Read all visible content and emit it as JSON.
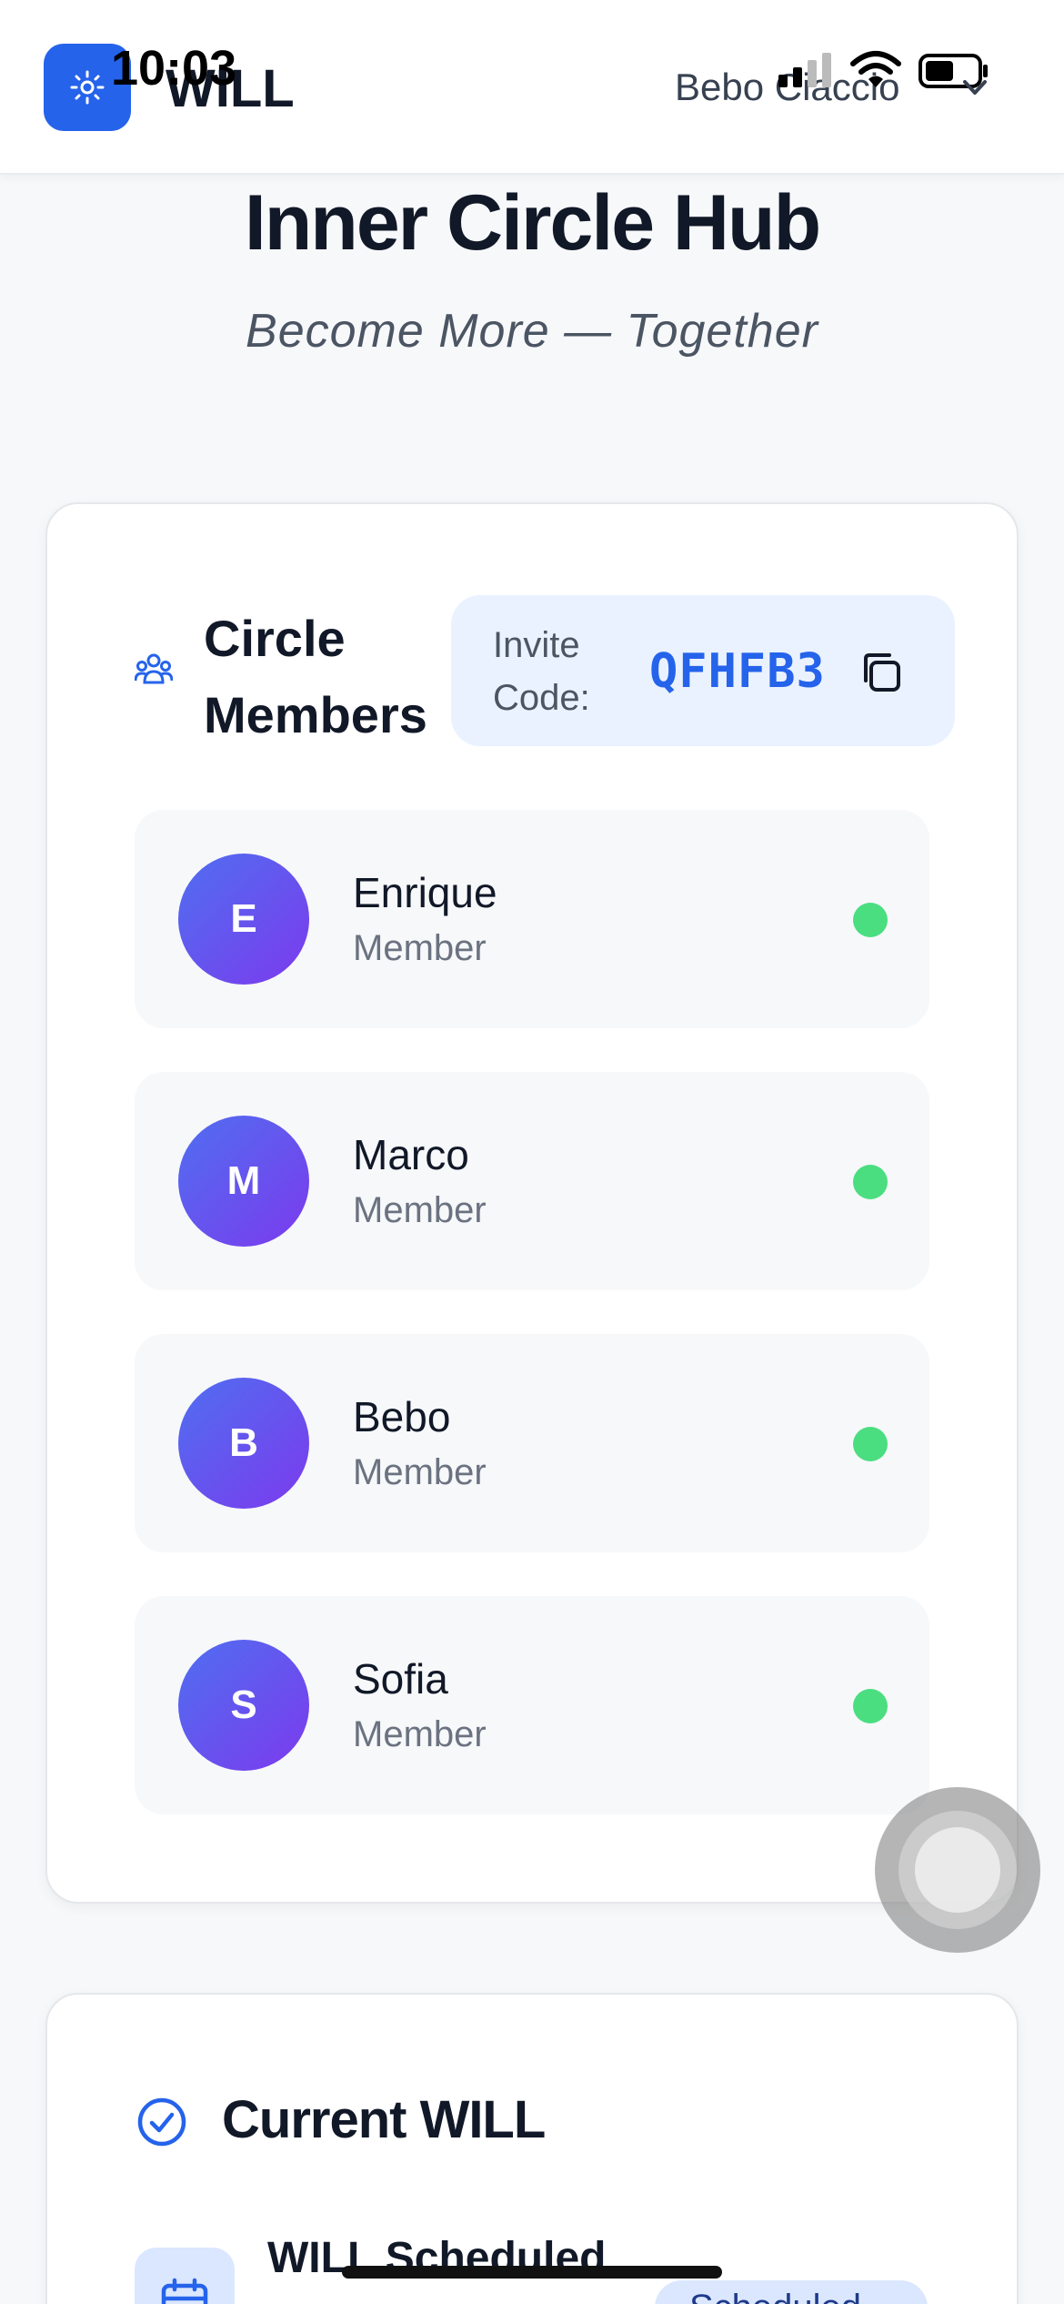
{
  "status_bar": {
    "time": "10:03"
  },
  "app_bar": {
    "brand": "WILL",
    "user_name": "Bebo Ciaccio"
  },
  "header": {
    "title": "Inner Circle Hub",
    "subtitle": "Become More — Together"
  },
  "members_section": {
    "heading": "Circle Members",
    "invite_label": "Invite Code:",
    "invite_code": "QFHFB3",
    "members": [
      {
        "initial": "E",
        "name": "Enrique",
        "role": "Member",
        "online": true
      },
      {
        "initial": "M",
        "name": "Marco",
        "role": "Member",
        "online": true
      },
      {
        "initial": "B",
        "name": "Bebo",
        "role": "Member",
        "online": true
      },
      {
        "initial": "S",
        "name": "Sofia",
        "role": "Member",
        "online": true
      }
    ]
  },
  "will_section": {
    "heading": "Current WILL",
    "status_title": "WILL Scheduled",
    "badge": "Scheduled"
  },
  "colors": {
    "accent": "#2563eb",
    "online": "#4ade80",
    "avatar_gradient_start": "#4f6ff0",
    "avatar_gradient_end": "#7c3aed",
    "invite_bg": "#eaf2ff"
  }
}
